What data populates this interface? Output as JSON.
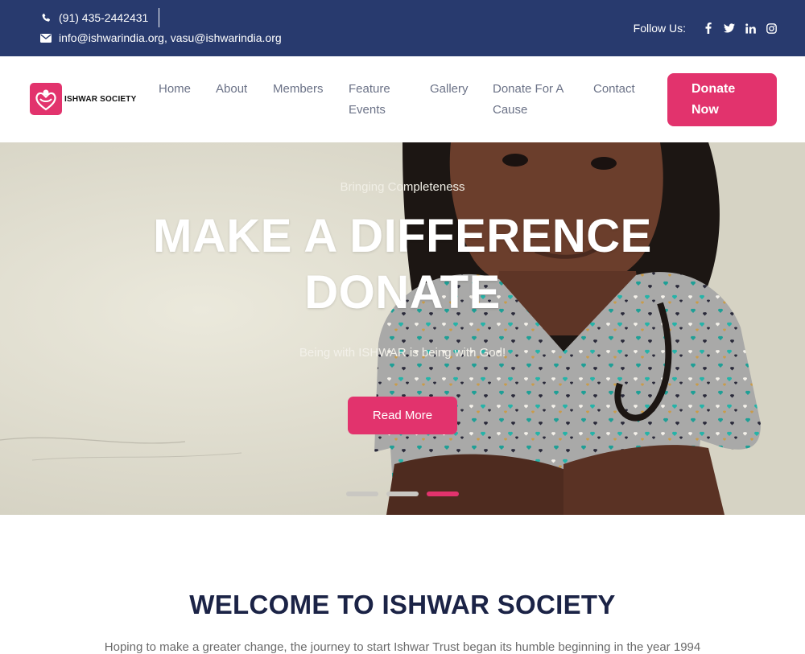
{
  "topbar": {
    "phone": "(91) 435-2442431",
    "email": "info@ishwarindia.org, vasu@ishwarindia.org",
    "follow_label": "Follow Us:",
    "social": [
      {
        "name": "facebook-icon",
        "glyph": "f"
      },
      {
        "name": "twitter-icon",
        "glyph": "twitter"
      },
      {
        "name": "linkedin-icon",
        "glyph": "in"
      },
      {
        "name": "instagram-icon",
        "glyph": "instagram"
      }
    ],
    "bg_color": "#283a6e"
  },
  "logo": {
    "text": "ISHWAR SOCIETY",
    "color": "#e2336d"
  },
  "nav": {
    "items": [
      {
        "label": "Home"
      },
      {
        "label": "About"
      },
      {
        "label": "Members"
      },
      {
        "label": "Feature Events"
      },
      {
        "label": "Gallery"
      },
      {
        "label": "Donate For A Cause"
      },
      {
        "label": "Contact"
      }
    ],
    "donate_label": "Donate Now"
  },
  "hero": {
    "tagline": "Bringing Completeness",
    "title_line1": "MAKE A DIFFERENCE",
    "title_line2": "DONATE",
    "subtitle": "Being with ISHWAR is being with God!",
    "button_label": "Read More",
    "slides": 3,
    "active_slide": 3
  },
  "welcome": {
    "title": "WELCOME TO ISHWAR SOCIETY",
    "text": "Hoping to make a greater change, the journey to start Ishwar Trust began its humble beginning in the year 1994"
  },
  "colors": {
    "accent": "#e2336d",
    "navy": "#283a6e",
    "heading": "#1b2346"
  }
}
